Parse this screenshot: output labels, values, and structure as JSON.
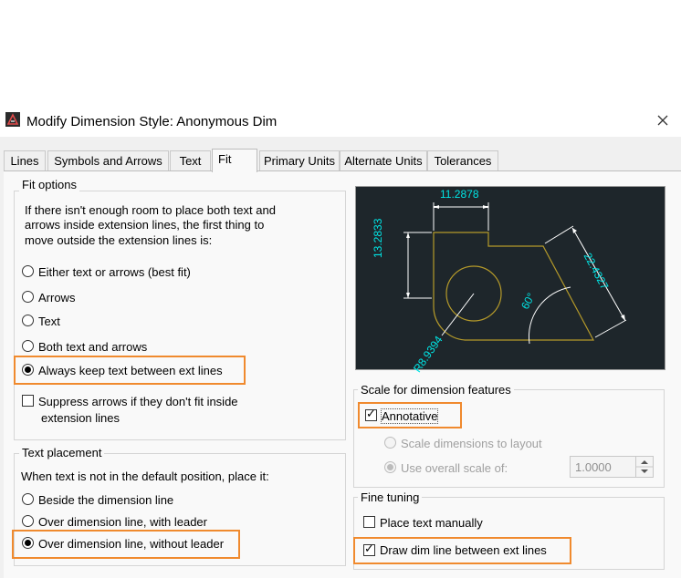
{
  "window": {
    "title": "Modify Dimension Style: Anonymous Dim"
  },
  "tabs": [
    {
      "label": "Lines"
    },
    {
      "label": "Symbols and Arrows"
    },
    {
      "label": "Text"
    },
    {
      "label": "Fit"
    },
    {
      "label": "Primary Units"
    },
    {
      "label": "Alternate Units"
    },
    {
      "label": "Tolerances"
    }
  ],
  "active_tab": "Fit",
  "fit_options": {
    "title": "Fit options",
    "description_lines": [
      "If there isn't enough room to place both text and",
      "arrows inside extension lines, the first thing to",
      "move outside the extension lines is:"
    ],
    "radios": [
      {
        "label": "Either text or arrows (best fit)",
        "selected": false
      },
      {
        "label": "Arrows",
        "selected": false
      },
      {
        "label": "Text",
        "selected": false
      },
      {
        "label": "Both text and arrows",
        "selected": false
      },
      {
        "label": "Always keep text between ext lines",
        "selected": true
      }
    ],
    "suppress": {
      "label_line1": "Suppress arrows if they don't fit inside",
      "label_line2": "extension lines",
      "checked": false
    }
  },
  "text_placement": {
    "title": "Text placement",
    "description": "When text is not in the default position, place it:",
    "radios": [
      {
        "label": "Beside the dimension line",
        "selected": false
      },
      {
        "label": "Over dimension line, with leader",
        "selected": false
      },
      {
        "label": "Over dimension line, without leader",
        "selected": true
      }
    ]
  },
  "preview": {
    "dims": [
      "11.2878",
      "13.2833",
      "22.4327",
      "60°",
      "R8.9394"
    ],
    "colors": {
      "background": "#1e262b",
      "dimension": "#00e5e5",
      "geometry": "#b59a2a",
      "lines": "#ffffff"
    }
  },
  "scale": {
    "title": "Scale for dimension features",
    "annotative": {
      "label": "Annotative",
      "checked": true
    },
    "layout_radio": {
      "label": "Scale dimensions to layout",
      "selected": false,
      "enabled": false
    },
    "overall_radio": {
      "label": "Use overall scale of:",
      "selected": true,
      "enabled": false
    },
    "overall_value": "1.0000"
  },
  "fine_tuning": {
    "title": "Fine tuning",
    "place_manually": {
      "label": "Place text manually",
      "checked": false
    },
    "draw_dim_line": {
      "label": "Draw dim line between ext lines",
      "checked": true
    }
  },
  "highlight_color": "#f08a2e"
}
